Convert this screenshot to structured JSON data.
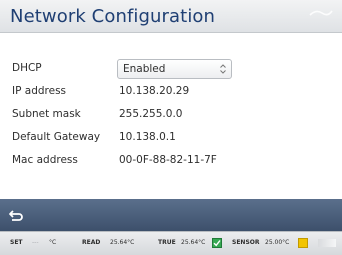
{
  "header": {
    "title": "Network Configuration"
  },
  "settings": {
    "dhcp": {
      "label": "DHCP",
      "value": "Enabled"
    },
    "ip_address": {
      "label": "IP address",
      "value": "10.138.20.29"
    },
    "subnet_mask": {
      "label": "Subnet mask",
      "value": "255.255.0.0"
    },
    "default_gateway": {
      "label": "Default Gateway",
      "value": "10.138.0.1"
    },
    "mac_address": {
      "label": "Mac address",
      "value": "00-0F-88-82-11-7F"
    }
  },
  "navigation": {
    "back_icon": "back-arrow-icon"
  },
  "status_bar": {
    "set_label": "SET",
    "set_value": "---",
    "set_unit": "°C",
    "read_label": "READ",
    "read_value": "25.64°C",
    "true_label": "TRUE",
    "true_value": "25.64°C",
    "sensor_label": "SENSOR",
    "sensor_value": "25.00°C",
    "true_status_icon": "check-icon",
    "sensor_status_color": "#f2c400"
  },
  "colors": {
    "title": "#1f3f73",
    "bottom_bar": "#4a5d7a",
    "status_ok": "#36a852",
    "status_warn": "#f2c400"
  }
}
